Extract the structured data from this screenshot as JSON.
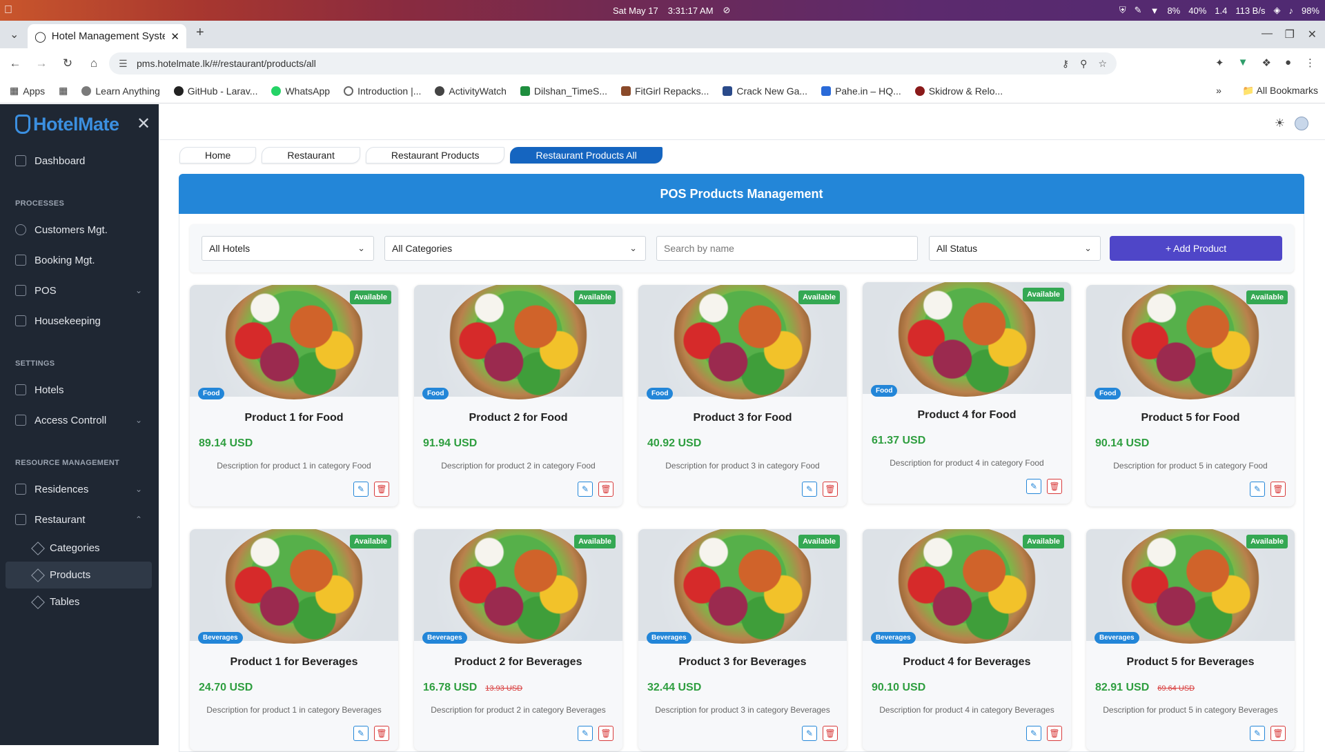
{
  "os": {
    "date": "Sat May 17",
    "time": "3:31:17 AM",
    "tray": [
      "8%",
      "40%",
      "1.4",
      "113 B/s",
      "98%"
    ]
  },
  "browser": {
    "tab_title": "Hotel Management System",
    "url": "pms.hotelmate.lk/#/restaurant/products/all",
    "bookmarks": [
      "Apps",
      "Learn Anything",
      "GitHub - Larav...",
      "WhatsApp",
      "Introduction |...",
      "ActivityWatch",
      "Dilshan_TimeS...",
      "FitGirl Repacks...",
      "Crack New Ga...",
      "Pahe.in – HQ...",
      "Skidrow & Relo..."
    ],
    "bookmark_colors": [
      "#555555",
      "#7a7a7a",
      "#222222",
      "#25d366",
      "#666666",
      "#444444",
      "#1e8e3e",
      "#8a4a2a",
      "#2a4a8a",
      "#2a6ad8",
      "#8a1a1a"
    ],
    "all_bookmarks": "All Bookmarks"
  },
  "sidebar": {
    "brand": "HotelMate",
    "dashboard": "Dashboard",
    "section_processes": "PROCESSES",
    "customers": "Customers Mgt.",
    "booking": "Booking Mgt.",
    "pos": "POS",
    "housekeeping": "Housekeeping",
    "section_settings": "SETTINGS",
    "hotels": "Hotels",
    "access": "Access Controll",
    "section_resource": "RESOURCE MANAGEMENT",
    "residences": "Residences",
    "restaurant": "Restaurant",
    "categories": "Categories",
    "products": "Products",
    "tables": "Tables"
  },
  "breadcrumb": [
    "Home",
    "Restaurant",
    "Restaurant Products",
    "Restaurant Products All"
  ],
  "panel": {
    "title": "POS Products Management"
  },
  "filters": {
    "hotel": "All Hotels",
    "category": "All Categories",
    "search_placeholder": "Search by name",
    "status": "All Status",
    "add_label": "+ Add Product"
  },
  "products": [
    {
      "name": "Product 1 for Food",
      "price": "89.14 USD",
      "old": "",
      "desc": "Description for product 1 in category Food",
      "category": "Food",
      "status": "Available"
    },
    {
      "name": "Product 2 for Food",
      "price": "91.94 USD",
      "old": "",
      "desc": "Description for product 2 in category Food",
      "category": "Food",
      "status": "Available"
    },
    {
      "name": "Product 3 for Food",
      "price": "40.92 USD",
      "old": "",
      "desc": "Description for product 3 in category Food",
      "category": "Food",
      "status": "Available"
    },
    {
      "name": "Product 4 for Food",
      "price": "61.37 USD",
      "old": "",
      "desc": "Description for product 4 in category Food",
      "category": "Food",
      "status": "Available"
    },
    {
      "name": "Product 5 for Food",
      "price": "90.14 USD",
      "old": "",
      "desc": "Description for product 5 in category Food",
      "category": "Food",
      "status": "Available"
    },
    {
      "name": "Product 1 for Beverages",
      "price": "24.70 USD",
      "old": "",
      "desc": "Description for product 1 in category Beverages",
      "category": "Beverages",
      "status": "Available"
    },
    {
      "name": "Product 2 for Beverages",
      "price": "16.78 USD",
      "old": "13.93 USD",
      "desc": "Description for product 2 in category Beverages",
      "category": "Beverages",
      "status": "Available"
    },
    {
      "name": "Product 3 for Beverages",
      "price": "32.44 USD",
      "old": "",
      "desc": "Description for product 3 in category Beverages",
      "category": "Beverages",
      "status": "Available"
    },
    {
      "name": "Product 4 for Beverages",
      "price": "90.10 USD",
      "old": "",
      "desc": "Description for product 4 in category Beverages",
      "category": "Beverages",
      "status": "Available"
    },
    {
      "name": "Product 5 for Beverages",
      "price": "82.91 USD",
      "old": "69.64 USD",
      "desc": "Description for product 5 in category Beverages",
      "category": "Beverages",
      "status": "Available"
    }
  ],
  "colors": {
    "accent": "#2386d8",
    "add_button": "#4f46c8",
    "available": "#34a853",
    "price": "#2e9e3f",
    "sidebar_bg": "#1f2733"
  }
}
